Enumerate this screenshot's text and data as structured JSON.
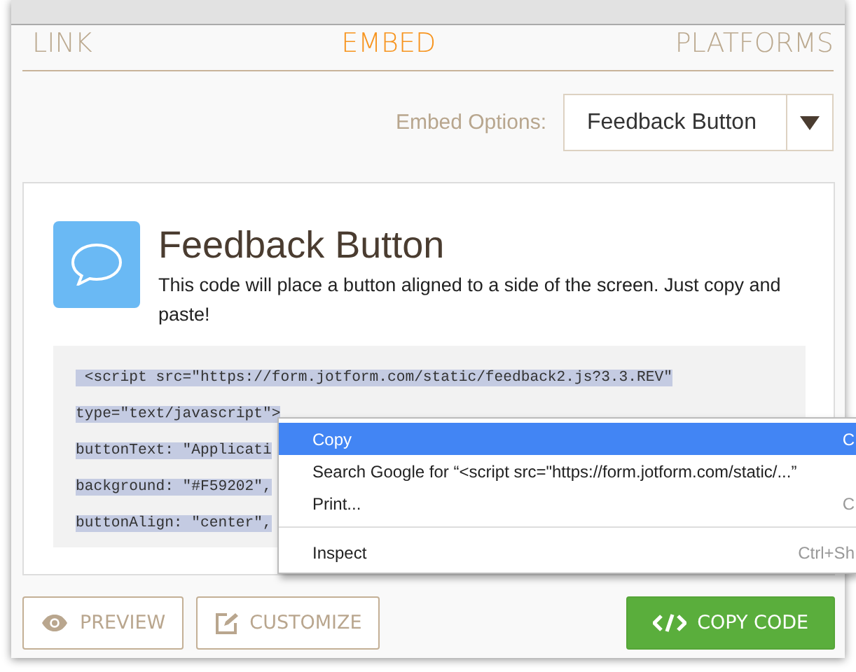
{
  "tabs": [
    {
      "label": "LINK",
      "selected": false
    },
    {
      "label": "EMBED",
      "selected": true
    },
    {
      "label": "PLATFORMS",
      "selected": false
    }
  ],
  "embed_options": {
    "label": "Embed Options:",
    "value": "Feedback Button"
  },
  "card": {
    "title": "Feedback Button",
    "description": "This code will place a button aligned to a side of the screen. Just copy and paste!",
    "code_selected": true,
    "code_lines": [
      " <script src=\"https://form.jotform.com/static/feedback2.js?3.3.REV\"",
      "type=\"text/javascript\">",
      "buttonText: \"Applicati",
      "background: \"#F59202\",",
      "buttonAlign: \"center\","
    ]
  },
  "context_menu": {
    "items": [
      {
        "label": "Copy",
        "shortcut": "C",
        "selected": true,
        "separator_before": false
      },
      {
        "label": "Search Google for “<script src=\"https://form.jotform.com/static/...”",
        "selected": false,
        "separator_before": false
      },
      {
        "label": "Print...",
        "shortcut": "C",
        "selected": false,
        "separator_before": false
      },
      {
        "label": "Inspect",
        "shortcut": "Ctrl+Sh",
        "selected": false,
        "separator_before": true
      }
    ]
  },
  "buttons": [
    {
      "label": "PREVIEW",
      "kind": "outline"
    },
    {
      "label": "CUSTOMIZE",
      "kind": "outline"
    },
    {
      "label": "COPY CODE",
      "kind": "primary"
    }
  ]
}
